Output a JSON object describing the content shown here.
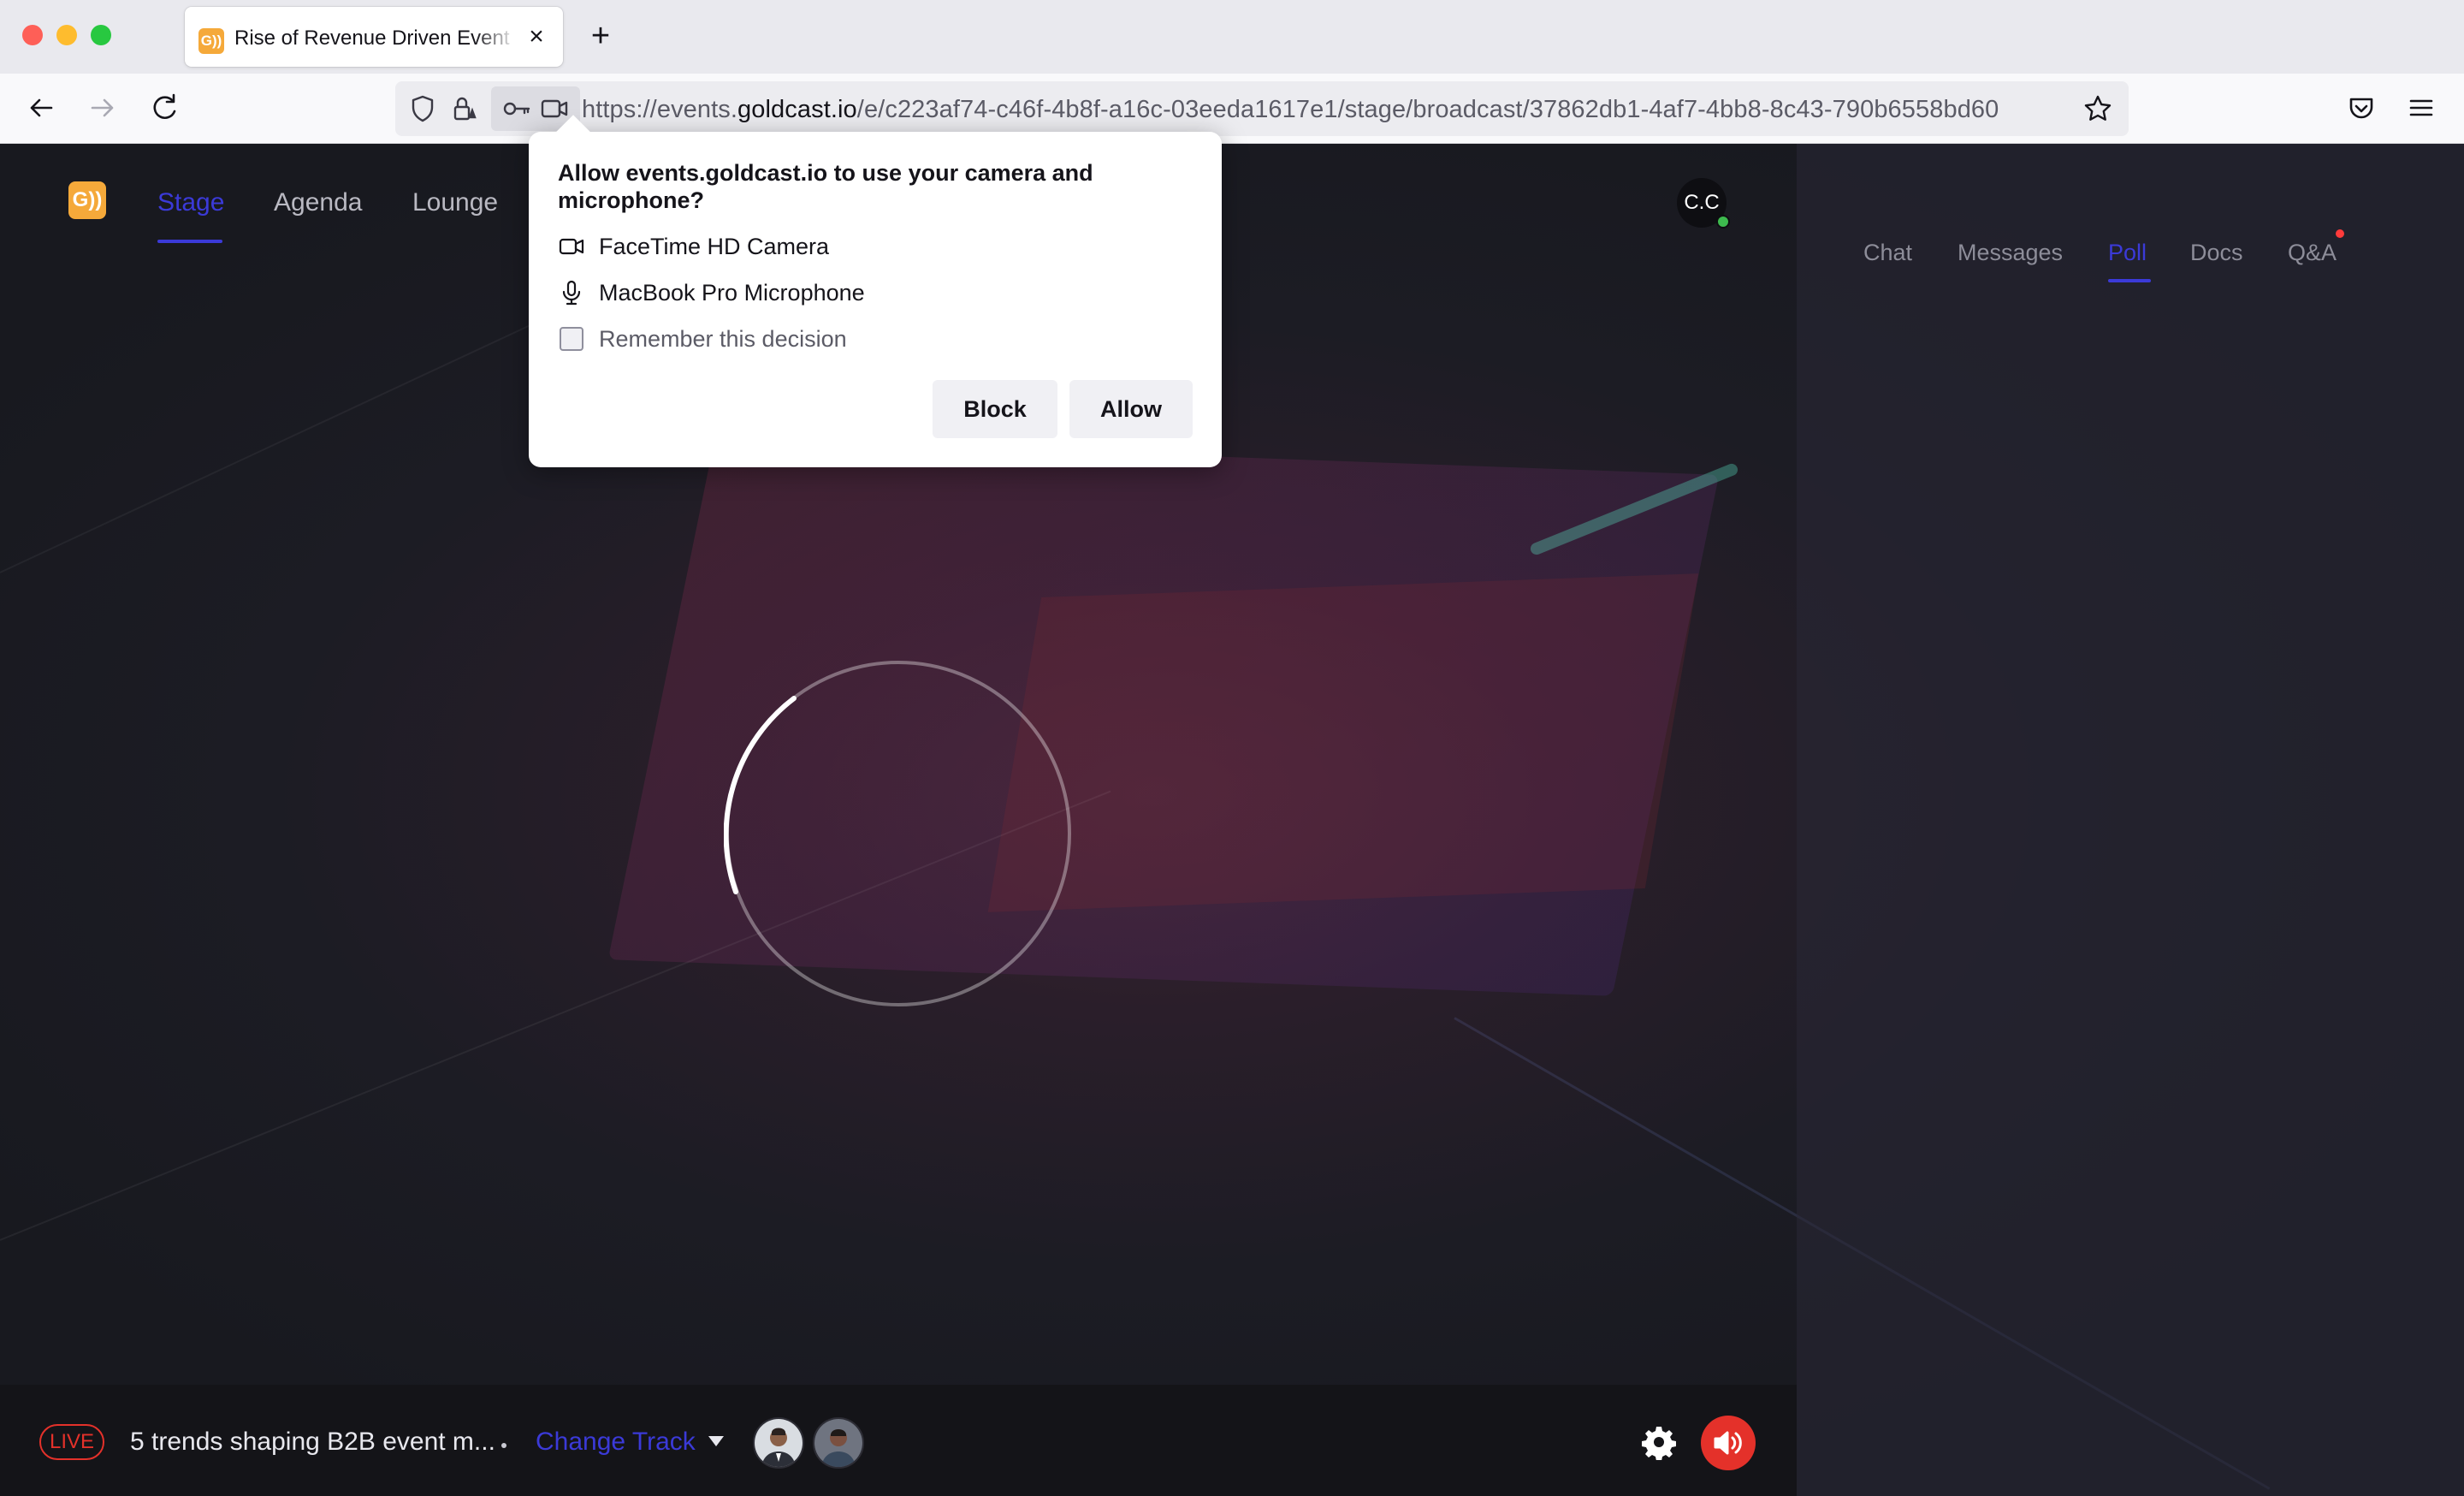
{
  "browser": {
    "tab_title": "Rise of Revenue Driven Event marketing",
    "tab_favicon": "G))",
    "url_prefix": "https://events.",
    "url_domain": "goldcast.io",
    "url_path": "/e/c223af74-c46f-4b8f-a16c-03eeda1617e1/stage/broadcast/37862db1-4af7-4bb8-8c43-790b6558bd60",
    "icons": [
      "back-arrow-icon",
      "forward-arrow-icon",
      "reload-icon",
      "shield-icon",
      "lock-icon",
      "key-icon",
      "camera-icon",
      "star-icon",
      "pocket-icon",
      "hamburger-menu-icon"
    ]
  },
  "permission_popup": {
    "title": "Allow events.goldcast.io to use your camera and microphone?",
    "camera_label": "FaceTime HD Camera",
    "microphone_label": "MacBook Pro Microphone",
    "remember_label": "Remember this decision",
    "remember_checked": false,
    "block_label": "Block",
    "allow_label": "Allow"
  },
  "app": {
    "logo": "G))",
    "nav": [
      {
        "label": "Stage",
        "active": true
      },
      {
        "label": "Agenda",
        "active": false
      },
      {
        "label": "Lounge",
        "active": false
      }
    ],
    "user_initials": "C.C",
    "side_tabs": [
      {
        "label": "Chat",
        "active": false
      },
      {
        "label": "Messages",
        "active": false
      },
      {
        "label": "Poll",
        "active": true
      },
      {
        "label": "Docs",
        "active": false
      },
      {
        "label": "Q&A",
        "active": false,
        "notification": true
      }
    ],
    "accent_color": "#3b3ad8",
    "live_color": "#e4312a"
  },
  "bottom_bar": {
    "live_label": "LIVE",
    "session_title": "5 trends shaping B2B event m...",
    "change_track_label": "Change Track"
  }
}
